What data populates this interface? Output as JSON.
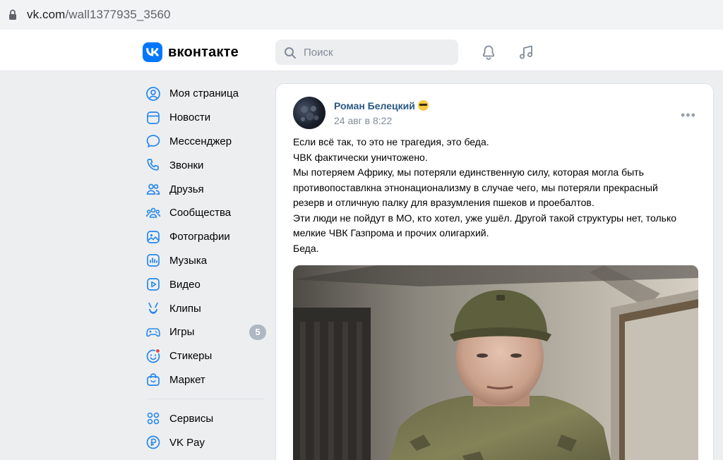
{
  "browser": {
    "url_host": "vk.com",
    "url_path": "/wall1377935_3560"
  },
  "header": {
    "logo_text": "вконтакте",
    "search_placeholder": "Поиск",
    "icons": [
      "bell-icon",
      "music-icon"
    ]
  },
  "sidebar": {
    "items": [
      {
        "label": "Моя страница",
        "icon": "user-circle-icon"
      },
      {
        "label": "Новости",
        "icon": "newsfeed-icon"
      },
      {
        "label": "Мессенджер",
        "icon": "message-icon"
      },
      {
        "label": "Звонки",
        "icon": "phone-icon"
      },
      {
        "label": "Друзья",
        "icon": "friends-icon"
      },
      {
        "label": "Сообщества",
        "icon": "communities-icon"
      },
      {
        "label": "Фотографии",
        "icon": "photo-icon"
      },
      {
        "label": "Музыка",
        "icon": "music-icon"
      },
      {
        "label": "Видео",
        "icon": "video-icon"
      },
      {
        "label": "Клипы",
        "icon": "clips-icon"
      },
      {
        "label": "Игры",
        "icon": "gamepad-icon",
        "badge": "5"
      },
      {
        "label": "Стикеры",
        "icon": "sticker-icon"
      },
      {
        "label": "Маркет",
        "icon": "market-icon"
      }
    ],
    "extra_items": [
      {
        "label": "Сервисы",
        "icon": "services-icon"
      },
      {
        "label": "VK Pay",
        "icon": "vkpay-icon"
      }
    ]
  },
  "post": {
    "author": "Роман Белецкий",
    "date": "24 авг в 8:22",
    "lines": [
      "Если всё так, то это не трагедия, это беда.",
      "ЧВК фактически уничтожено.",
      "Мы потеряем Африку, мы потеряли единственную силу, которая могла быть",
      "противопоставлкна этнонационализму в случае чего, мы потеряли прекрасный",
      "резерв и отличную палку для вразумления пшеков и проебалтов.",
      "Эти люди не пойдут в МО, кто хотел, уже ушёл. Другой такой структуры нет, только",
      "мелкие ЧВК Газпрома и прочих олигархий.",
      "Беда."
    ]
  },
  "colors": {
    "vk_blue": "#0077ff",
    "link": "#2a5885",
    "background": "#edeef0",
    "secondary_text": "#818c99"
  }
}
